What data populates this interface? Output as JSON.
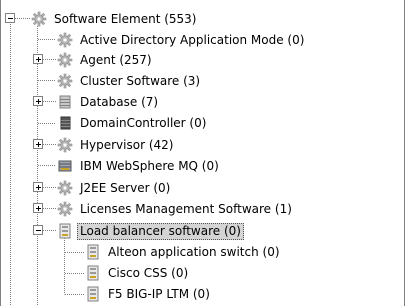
{
  "tree": {
    "items": [
      {
        "label": "Software Element (553)",
        "icon": "gear-icon",
        "toggle": "minus"
      },
      {
        "label": "Active Directory Application Mode (0)",
        "icon": "gear-icon",
        "toggle": ""
      },
      {
        "label": "Agent (257)",
        "icon": "gear-icon",
        "toggle": "plus"
      },
      {
        "label": "Cluster Software (3)",
        "icon": "gear-icon",
        "toggle": ""
      },
      {
        "label": "Database (7)",
        "icon": "database-icon",
        "toggle": "plus"
      },
      {
        "label": "DomainController (0)",
        "icon": "database-dark-icon",
        "toggle": ""
      },
      {
        "label": "Hypervisor (42)",
        "icon": "gear-icon",
        "toggle": "plus"
      },
      {
        "label": "IBM WebSphere MQ (0)",
        "icon": "message-queue-icon",
        "toggle": ""
      },
      {
        "label": "J2EE Server (0)",
        "icon": "gear-icon",
        "toggle": "plus"
      },
      {
        "label": "Licenses Management Software (1)",
        "icon": "gear-icon",
        "toggle": "plus"
      },
      {
        "label": "Load balancer software (0)",
        "icon": "load-balancer-icon",
        "toggle": "minus",
        "selected": true
      },
      {
        "label": "Alteon application switch (0)",
        "icon": "load-balancer-icon",
        "toggle": ""
      },
      {
        "label": "Cisco CSS (0)",
        "icon": "load-balancer-icon",
        "toggle": ""
      },
      {
        "label": "F5 BIG-IP LTM (0)",
        "icon": "load-balancer-icon",
        "toggle": ""
      }
    ]
  },
  "colors": {
    "selection": "#d4d4d4",
    "tree_line": "#808080",
    "gear": "#b8b8b8"
  }
}
